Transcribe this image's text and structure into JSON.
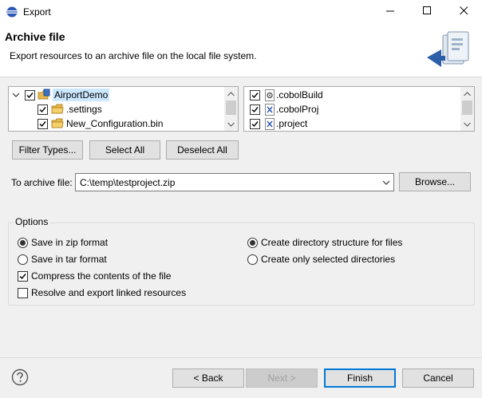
{
  "window": {
    "title": "Export",
    "controls": [
      "minimize",
      "maximize",
      "close"
    ]
  },
  "banner": {
    "title": "Archive file",
    "description": "Export resources to an archive file on the local file system."
  },
  "left_tree": {
    "items": [
      {
        "label": "AirportDemo",
        "checked": true,
        "expanded": true,
        "selected": true,
        "icon": "project-icon"
      },
      {
        "label": ".settings",
        "checked": true,
        "icon": "folder-icon"
      },
      {
        "label": "New_Configuration.bin",
        "checked": true,
        "icon": "folder-icon"
      }
    ]
  },
  "right_tree": {
    "items": [
      {
        "label": ".cobolBuild",
        "checked": true,
        "icon": "gear-file-icon"
      },
      {
        "label": ".cobolProj",
        "checked": true,
        "icon": "xml-file-icon"
      },
      {
        "label": ".project",
        "checked": true,
        "icon": "xml-file-icon"
      }
    ]
  },
  "selection_buttons": {
    "filter_types": "Filter Types...",
    "select_all": "Select All",
    "deselect_all": "Deselect All"
  },
  "archive": {
    "label": "To archive file:",
    "value": "C:\\temp\\testproject.zip",
    "browse": "Browse..."
  },
  "options": {
    "label": "Options",
    "format": [
      {
        "label": "Save in zip format",
        "selected": true
      },
      {
        "label": "Save in tar format",
        "selected": false
      }
    ],
    "compress": {
      "label": "Compress the contents of the file",
      "checked": true
    },
    "resolve_links": {
      "label": "Resolve and export linked resources",
      "checked": false
    },
    "structure": [
      {
        "label": "Create directory structure for files",
        "selected": true
      },
      {
        "label": "Create only selected directories",
        "selected": false
      }
    ]
  },
  "footer": {
    "back": "< Back",
    "next": "Next >",
    "finish": "Finish",
    "cancel": "Cancel"
  },
  "colors": {
    "accent": "#0078d7",
    "selection_bg": "#cce8ff",
    "folder": "#e8b84a"
  }
}
